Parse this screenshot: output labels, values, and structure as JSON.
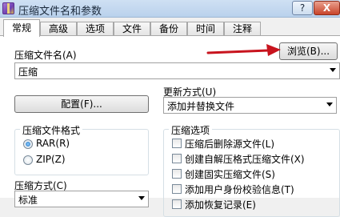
{
  "window": {
    "title": "压缩文件名和参数",
    "help_label": "?",
    "close_label": "X"
  },
  "tabs": [
    {
      "label": "常规",
      "active": true
    },
    {
      "label": "高级",
      "active": false
    },
    {
      "label": "选项",
      "active": false
    },
    {
      "label": "文件",
      "active": false
    },
    {
      "label": "备份",
      "active": false
    },
    {
      "label": "时间",
      "active": false
    },
    {
      "label": "注释",
      "active": false
    }
  ],
  "archive_name": {
    "label": "压缩文件名(A)",
    "value": "压缩",
    "browse_label": "浏览(B)..."
  },
  "update_mode": {
    "label": "更新方式(U)",
    "value": "添加并替换文件"
  },
  "profiles": {
    "label": "配置(F)..."
  },
  "format": {
    "label": "压缩文件格式",
    "options": [
      {
        "label": "RAR(R)",
        "selected": true
      },
      {
        "label": "ZIP(Z)",
        "selected": false
      }
    ]
  },
  "archiving_options": {
    "label": "压缩选项",
    "items": [
      {
        "label": "压缩后删除源文件(L)",
        "checked": false
      },
      {
        "label": "创建自解压格式压缩文件(X)",
        "checked": false
      },
      {
        "label": "创建固实压缩文件(S)",
        "checked": false
      },
      {
        "label": "添加用户身份校验信息(T)",
        "checked": false
      },
      {
        "label": "添加恢复记录(E)",
        "checked": false
      }
    ]
  },
  "method": {
    "label": "压缩方式(C)",
    "value": "标准"
  },
  "colors": {
    "annotation_arrow": "#c8141e",
    "title_bar": "#c4d9f0"
  },
  "icons": {
    "app": "winrar-icon",
    "annotation": "red-arrow-icon"
  }
}
